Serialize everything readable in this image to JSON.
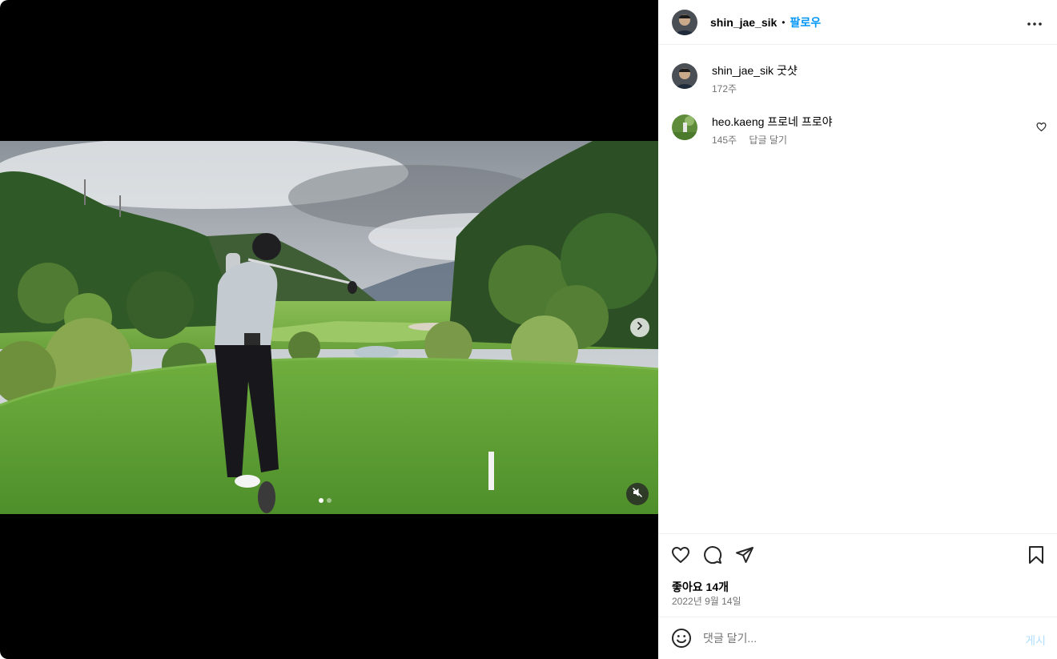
{
  "post": {
    "author": "shin_jae_sik",
    "separator": "•",
    "follow_label": "팔로우",
    "more_icon": "more-horizontal-icon"
  },
  "comments": [
    {
      "username": "shin_jae_sik",
      "text": "굿샷",
      "age": "172주"
    },
    {
      "username": "heo.kaeng",
      "text": "프로네 프로야",
      "age": "145주",
      "reply_label": "답글 달기"
    }
  ],
  "actions": {
    "like_icon": "heart-icon",
    "comment_icon": "comment-icon",
    "share_icon": "paper-plane-icon",
    "save_icon": "bookmark-icon",
    "likes_label": "좋아요 14개",
    "date": "2022년 9월 14일"
  },
  "comment_box": {
    "placeholder": "댓글 달기...",
    "post_label": "게시",
    "emoji_icon": "emoji-icon"
  },
  "media": {
    "carousel_count": 2,
    "carousel_active": 1,
    "muted": true
  },
  "colors": {
    "link_blue": "#0095f6",
    "post_disabled": "#b2dffc",
    "muted_text": "#737373",
    "divider": "#efefef"
  }
}
